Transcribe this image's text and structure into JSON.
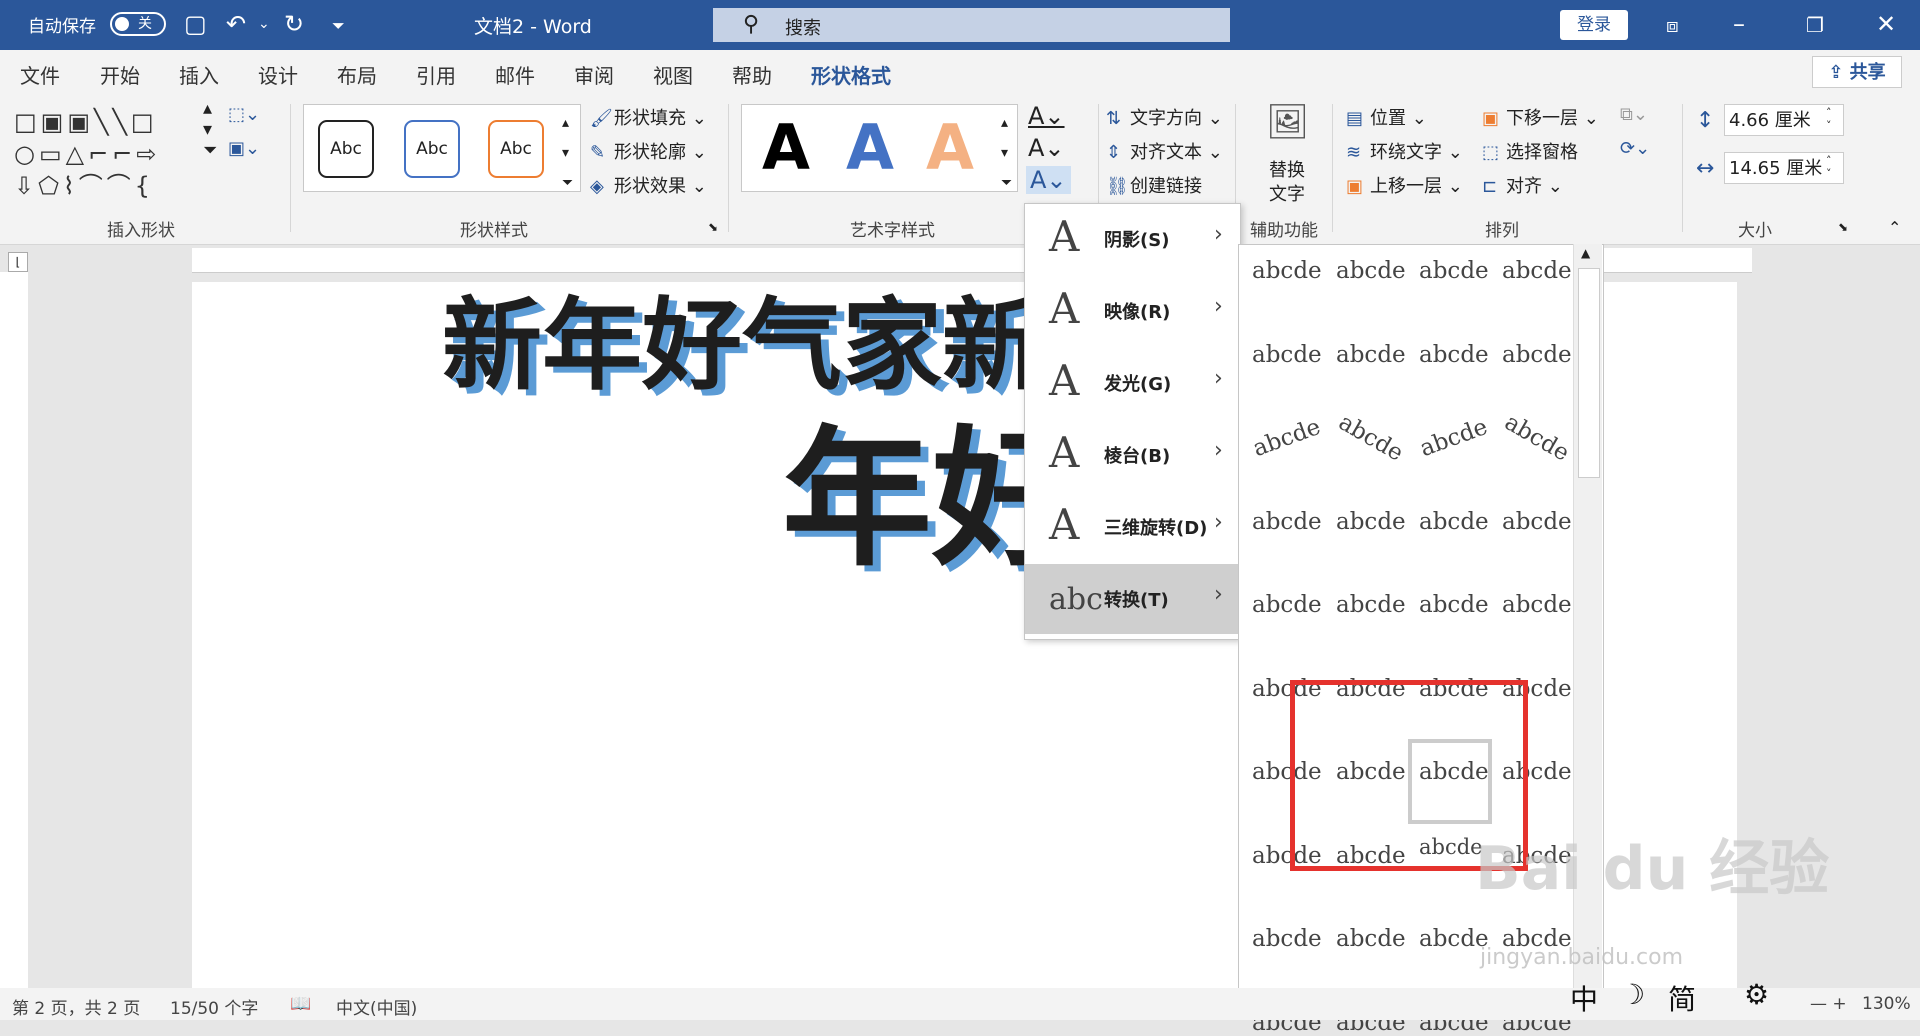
{
  "titlebar": {
    "autosave_label": "自动保存",
    "autosave_state": "关",
    "doc_title": "文档2 - Word",
    "search_placeholder": "搜索",
    "login_label": "登录"
  },
  "tabs": [
    {
      "label": "文件"
    },
    {
      "label": "开始"
    },
    {
      "label": "插入"
    },
    {
      "label": "设计"
    },
    {
      "label": "布局"
    },
    {
      "label": "引用"
    },
    {
      "label": "邮件"
    },
    {
      "label": "审阅"
    },
    {
      "label": "视图"
    },
    {
      "label": "帮助"
    },
    {
      "label": "形状格式"
    }
  ],
  "share_label": "共享",
  "ribbon": {
    "groups": {
      "insert_shapes": "插入形状",
      "shape_styles": "形状样式",
      "wordart_styles": "艺术字样式",
      "accessibility": "辅助功能",
      "arrange": "排列",
      "size": "大小"
    },
    "style_preset_label": "Abc",
    "shape_fill": "形状填充",
    "shape_outline": "形状轮廓",
    "shape_effects": "形状效果",
    "text_direction": "文字方向",
    "align_text": "对齐文本",
    "create_link": "创建链接",
    "alt_text_line1": "替换",
    "alt_text_line2": "文字",
    "position": "位置",
    "wrap_text": "环绕文字",
    "bring_forward": "上移一层",
    "send_backward": "下移一层",
    "selection_pane": "选择窗格",
    "align": "对齐",
    "height": "4.66 厘米",
    "width": "14.65 厘米",
    "wordart_letter": "A"
  },
  "document": {
    "line1": "新年好气家新",
    "line2": "年好饭"
  },
  "effects_menu": [
    {
      "label": "阴影(S)"
    },
    {
      "label": "映像(R)"
    },
    {
      "label": "发光(G)"
    },
    {
      "label": "棱台(B)"
    },
    {
      "label": "三维旋转(D)"
    },
    {
      "label": "转换(T)"
    }
  ],
  "transform_sample": "abcde",
  "transform_sample_short": "abc",
  "status": {
    "page": "第 2 页，共 2 页",
    "words": "15/50 个字",
    "language": "中文(中国)",
    "zoom": "130%",
    "ime_mode": "中",
    "ime_script": "简"
  },
  "watermark": {
    "brand": "Bai du 经验",
    "url": "jingyan.baidu.com"
  },
  "colors": {
    "titlebar": "#2b579a",
    "highlight": "#e5322d",
    "shadow": "#5b9bd5"
  }
}
